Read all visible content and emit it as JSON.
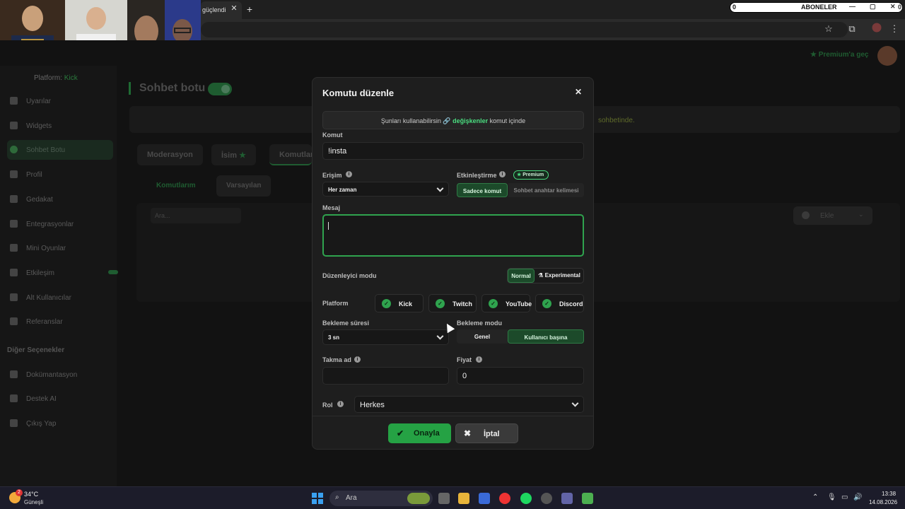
{
  "browser": {
    "tab_title": "güçlendi",
    "tab_close": "✕",
    "new_tab": "+"
  },
  "overlay": {
    "subscriber_count": "0",
    "subscriber_label": "ABONELER",
    "end_count": "0"
  },
  "site": {
    "platform_label": "Platform:",
    "platform_value": "Kick",
    "premium_link": "Premium'a geç",
    "page_title": "Sohbet botu",
    "banner_tail": "sohbetinde.",
    "nav": [
      {
        "label": "Uyarılar",
        "icon": "alert-icon"
      },
      {
        "label": "Widgets",
        "icon": "widgets-icon"
      },
      {
        "label": "Sohbet Botu",
        "icon": "bot-icon"
      },
      {
        "label": "Profil",
        "icon": "profile-icon"
      },
      {
        "label": "Gedakat",
        "icon": "trophy-icon"
      },
      {
        "label": "Entegrasyonlar",
        "icon": "integrations-icon"
      },
      {
        "label": "Mini Oyunlar",
        "icon": "games-icon"
      },
      {
        "label": "Etkileşim",
        "icon": "music-icon"
      },
      {
        "label": "Alt Kullanıcılar",
        "icon": "users-icon"
      },
      {
        "label": "Referanslar",
        "icon": "referrals-icon"
      }
    ],
    "other_section": "Diğer Seçenekler",
    "other_nav": [
      {
        "label": "Dokümantasyon",
        "icon": "docs-icon"
      },
      {
        "label": "Destek AI",
        "icon": "support-icon"
      },
      {
        "label": "Çıkış Yap",
        "icon": "logout-icon"
      }
    ],
    "tabs": [
      "Moderasyon",
      "İsim",
      "Komutlar"
    ],
    "subtabs": [
      "Komutlarım",
      "Varsayılan"
    ],
    "search_placeholder": "Ara...",
    "add_label": "Ekle"
  },
  "modal": {
    "title": "Komutu düzenle",
    "close": "✕",
    "hint_prefix": "Şunları kullanabilirsin",
    "hint_link": "🔗 değişkenler",
    "hint_suffix": "komut içinde",
    "command_label": "Komut",
    "command_value": "!insta",
    "access_label": "Erişim",
    "access_value": "Her zaman",
    "activation_label": "Etkinleştirme",
    "premium_badge": "Premium",
    "activation_options": [
      "Sadece komut",
      "Sohbet anahtar kelimesi"
    ],
    "activation_selected": "Sadece komut",
    "message_label": "Mesaj",
    "message_value": "",
    "editor_mode_label": "Düzenleyici modu",
    "editor_modes": [
      "Normal",
      "Experimental"
    ],
    "editor_selected": "Normal",
    "platform_label": "Platform",
    "platforms": [
      {
        "label": "Kick",
        "checked": true
      },
      {
        "label": "Twitch",
        "checked": true
      },
      {
        "label": "YouTube",
        "checked": true
      },
      {
        "label": "Discord",
        "checked": true
      }
    ],
    "cooldown_label": "Bekleme süresi",
    "cooldown_value": "3 sn",
    "cooldown_mode_label": "Bekleme modu",
    "cooldown_modes": [
      "Genel",
      "Kullanıcı başına"
    ],
    "cooldown_mode_selected": "Kullanıcı başına",
    "alias_label": "Takma ad",
    "alias_value": "",
    "price_label": "Fiyat",
    "price_value": "0",
    "role_label": "Rol",
    "role_value": "Herkes",
    "confirm_label": "Onayla",
    "cancel_label": "İptal"
  },
  "taskbar": {
    "weather_badge": "2",
    "temperature": "34°C",
    "weather": "Güneşli",
    "search_label": "Ara",
    "time": "13:38",
    "date": "14.08.2026"
  },
  "colors": {
    "accent_green": "#2fa34e",
    "modal_bg": "#1e1e1e",
    "page_bg": "#121212"
  }
}
